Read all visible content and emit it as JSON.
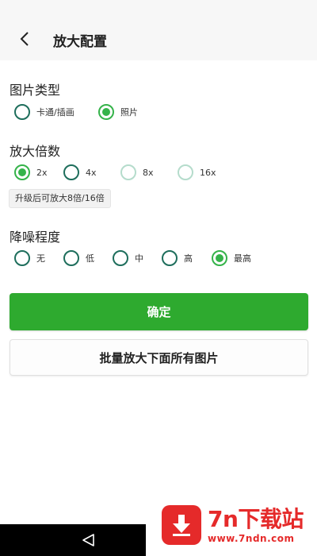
{
  "header": {
    "title": "放大配置"
  },
  "image_type": {
    "title": "图片类型",
    "options": [
      {
        "label": "卡通/插画",
        "checked": false
      },
      {
        "label": "照片",
        "checked": true
      }
    ]
  },
  "scale": {
    "title": "放大倍数",
    "options": [
      {
        "label": "2x",
        "checked": true,
        "enabled": true
      },
      {
        "label": "4x",
        "checked": false,
        "enabled": true
      },
      {
        "label": "8x",
        "checked": false,
        "enabled": false
      },
      {
        "label": "16x",
        "checked": false,
        "enabled": false
      }
    ],
    "tip": "升级后可放大8倍/16倍"
  },
  "denoise": {
    "title": "降噪程度",
    "options": [
      {
        "label": "无",
        "checked": false
      },
      {
        "label": "低",
        "checked": false
      },
      {
        "label": "中",
        "checked": false
      },
      {
        "label": "高",
        "checked": false
      },
      {
        "label": "最高",
        "checked": true
      }
    ]
  },
  "buttons": {
    "confirm": "确定",
    "batch": "批量放大下面所有图片"
  },
  "watermark": {
    "name": "7n下载站",
    "url": "www.7ndn.com"
  },
  "colors": {
    "accent": "#2eaa2f",
    "radio_border": "#1e6e5c",
    "watermark": "#e52a2a"
  },
  "icons": {
    "back": "chevron-left-icon",
    "nav_back": "triangle-back-icon",
    "watermark_logo": "download-arrow-icon"
  }
}
